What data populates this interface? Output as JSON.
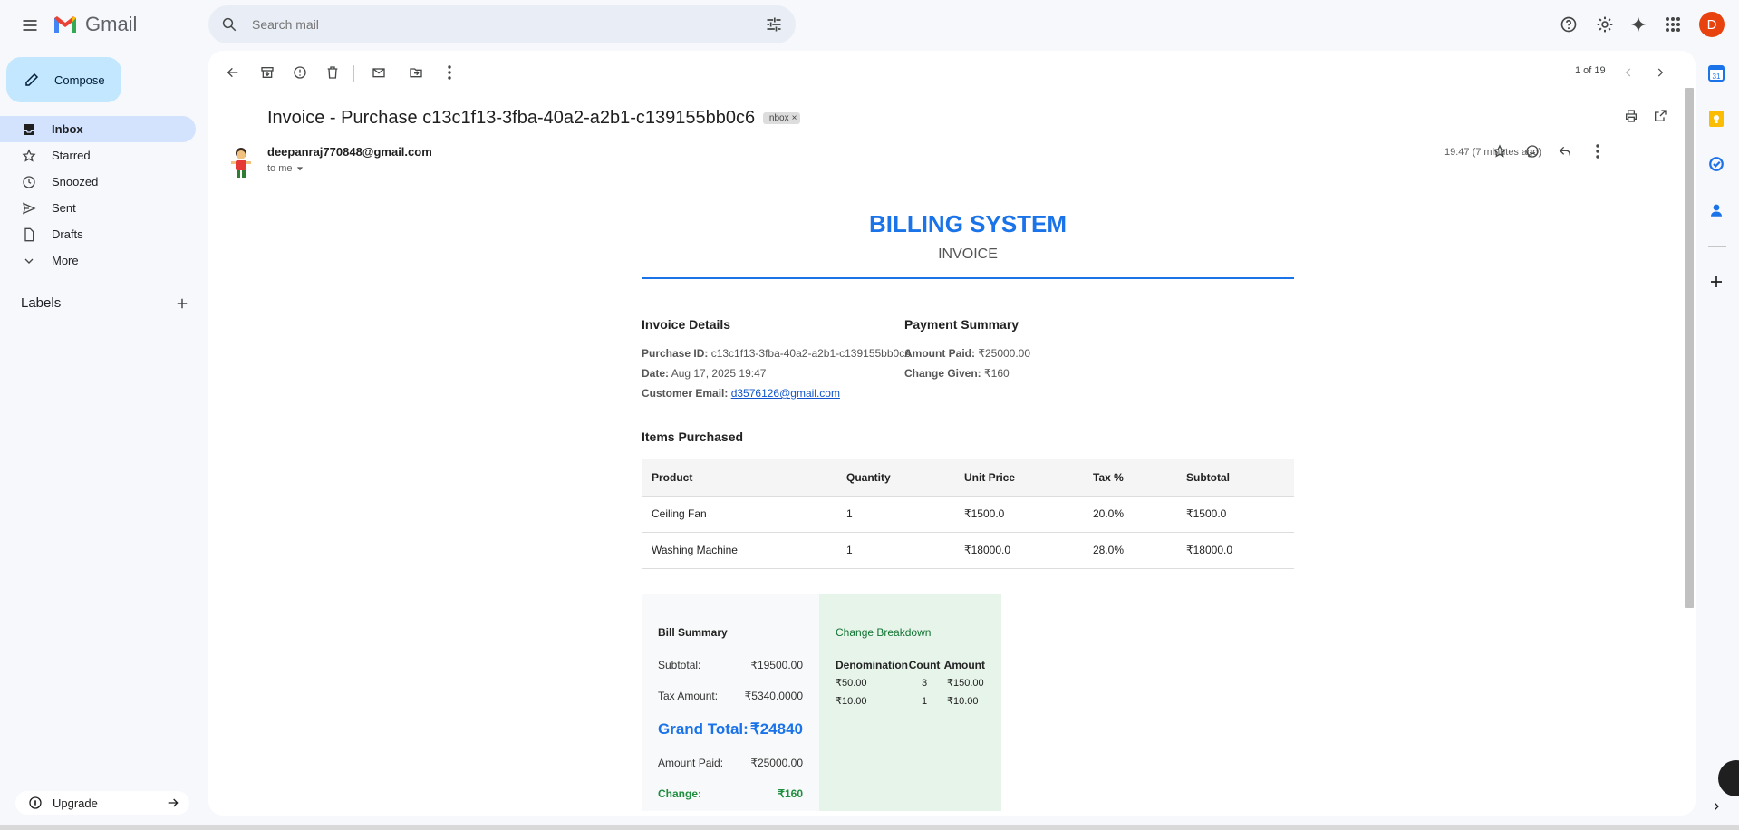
{
  "app": {
    "name": "Gmail"
  },
  "search": {
    "placeholder": "Search mail"
  },
  "header": {
    "avatar_letter": "D"
  },
  "compose": {
    "label": "Compose"
  },
  "nav": {
    "items": [
      {
        "label": "Inbox",
        "icon": "inbox-icon",
        "active": true
      },
      {
        "label": "Starred",
        "icon": "star-icon"
      },
      {
        "label": "Snoozed",
        "icon": "clock-icon"
      },
      {
        "label": "Sent",
        "icon": "send-icon"
      },
      {
        "label": "Drafts",
        "icon": "draft-icon"
      },
      {
        "label": "More",
        "icon": "chevron-down-icon"
      }
    ],
    "labels_title": "Labels",
    "upgrade": "Upgrade"
  },
  "toolbar": {
    "pager": "1 of 19"
  },
  "email": {
    "subject": "Invoice - Purchase c13c1f13-3fba-40a2-a2b1-c139155bb0c6",
    "chip": "Inbox",
    "sender": "deepanraj770848@gmail.com",
    "to": "to me",
    "time": "19:47 (7 minutes ago)"
  },
  "invoice": {
    "title": "BILLING SYSTEM",
    "subtitle": "INVOICE",
    "details_heading": "Invoice Details",
    "purchase_id_label": "Purchase ID:",
    "purchase_id": "c13c1f13-3fba-40a2-a2b1-c139155bb0c6",
    "date_label": "Date:",
    "date": "Aug 17, 2025 19:47",
    "email_label": "Customer Email:",
    "email": "d3576126@gmail.com",
    "payment_heading": "Payment Summary",
    "amount_paid_label": "Amount Paid:",
    "amount_paid": "₹25000.00",
    "change_given_label": "Change Given:",
    "change_given": "₹160",
    "items_heading": "Items Purchased",
    "columns": [
      "Product",
      "Quantity",
      "Unit Price",
      "Tax %",
      "Subtotal"
    ],
    "rows": [
      [
        "Ceiling Fan",
        "1",
        "₹1500.0",
        "20.0%",
        "₹1500.0"
      ],
      [
        "Washing Machine",
        "1",
        "₹18000.0",
        "28.0%",
        "₹18000.0"
      ]
    ],
    "bill": {
      "heading": "Bill Summary",
      "subtotal_label": "Subtotal:",
      "subtotal": "₹19500.00",
      "tax_label": "Tax Amount:",
      "tax": "₹5340.0000",
      "grand_label": "Grand Total:",
      "grand": "₹24840",
      "paid_label": "Amount Paid:",
      "paid": "₹25000.00",
      "change_label": "Change:",
      "change": "₹160"
    },
    "breakdown": {
      "heading": "Change Breakdown",
      "columns": [
        "Denomination",
        "Count",
        "Amount"
      ],
      "rows": [
        [
          "₹50.00",
          "3",
          "₹150.00"
        ],
        [
          "₹10.00",
          "1",
          "₹10.00"
        ]
      ]
    }
  },
  "colors": {
    "accent": "#1a73e8",
    "compose_bg": "#c2e7ff",
    "active_nav": "#d3e3fd",
    "avatar": "#e8430f",
    "breakdown_bg": "#e6f4ea"
  }
}
